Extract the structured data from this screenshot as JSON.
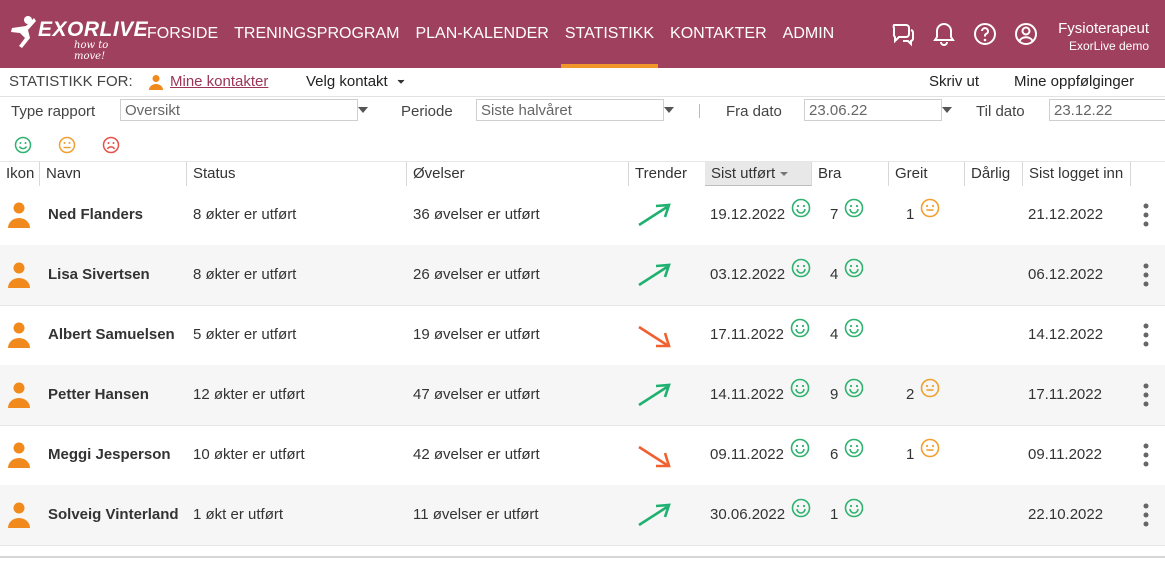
{
  "brand": {
    "name": "EXORLIVE",
    "tagline": "how to move!"
  },
  "nav": [
    {
      "label": "FORSIDE",
      "active": false
    },
    {
      "label": "TRENINGSPROGRAM",
      "active": false
    },
    {
      "label": "PLAN-KALENDER",
      "active": false
    },
    {
      "label": "STATISTIKK",
      "active": true
    },
    {
      "label": "KONTAKTER",
      "active": false
    },
    {
      "label": "ADMIN",
      "active": false
    }
  ],
  "top_icons": [
    "chat-icon",
    "bell-icon",
    "help-icon",
    "user-circle-icon"
  ],
  "user": {
    "name": "Fysioterapeut",
    "org": "ExorLive demo"
  },
  "subbar": {
    "label": "STATISTIKK FOR:",
    "contacts_link": "Mine kontakter",
    "select_contact": "Velg kontakt",
    "print": "Skriv ut",
    "followups": "Mine oppfølginger"
  },
  "filters": {
    "report_type_label": "Type rapport",
    "report_type_value": "Oversikt",
    "period_label": "Periode",
    "period_value": "Siste halvåret",
    "from_label": "Fra dato",
    "from_value": "23.06.22",
    "to_label": "Til dato",
    "to_value": "23.12.22"
  },
  "mood_filters": [
    "happy-face-icon",
    "neutral-face-icon",
    "sad-face-icon"
  ],
  "table": {
    "headers": {
      "icon": "Ikon",
      "name": "Navn",
      "status": "Status",
      "exercises": "Øvelser",
      "trends": "Trender",
      "last_done": "Sist utført",
      "good": "Bra",
      "ok": "Greit",
      "bad": "Dårlig",
      "last_login": "Sist logget inn"
    },
    "sorted_by": "last_done",
    "rows": [
      {
        "name": "Ned Flanders",
        "status": "8 økter er utført",
        "exercises": "36 øvelser er utført",
        "trend": "up",
        "last_done": "19.12.2022",
        "good": "7",
        "ok": "1",
        "bad": "",
        "last_login": "21.12.2022"
      },
      {
        "name": "Lisa Sivertsen",
        "status": "8 økter er utført",
        "exercises": "26 øvelser er utført",
        "trend": "up",
        "last_done": "03.12.2022",
        "good": "4",
        "ok": "",
        "bad": "",
        "last_login": "06.12.2022"
      },
      {
        "name": "Albert Samuelsen",
        "status": "5 økter er utført",
        "exercises": "19 øvelser er utført",
        "trend": "down",
        "last_done": "17.11.2022",
        "good": "4",
        "ok": "",
        "bad": "",
        "last_login": "14.12.2022"
      },
      {
        "name": "Petter Hansen",
        "status": "12 økter er utført",
        "exercises": "47 øvelser er utført",
        "trend": "up",
        "last_done": "14.11.2022",
        "good": "9",
        "ok": "2",
        "bad": "",
        "last_login": "17.11.2022"
      },
      {
        "name": "Meggi Jesperson",
        "status": "10 økter er utført",
        "exercises": "42 øvelser er utført",
        "trend": "down",
        "last_done": "09.11.2022",
        "good": "6",
        "ok": "1",
        "bad": "",
        "last_login": "09.11.2022"
      },
      {
        "name": "Solveig Vinterland",
        "status": "1 økt er utført",
        "exercises": "11 øvelser er utført",
        "trend": "up",
        "last_done": "30.06.2022",
        "good": "1",
        "ok": "",
        "bad": "",
        "last_login": "22.10.2022"
      }
    ]
  },
  "colors": {
    "header_bg": "#a0405f",
    "nav_active": "#f0962a",
    "link": "#9b3456",
    "good": "#2fb26f",
    "ok": "#f0a030",
    "bad": "#e8504a",
    "trend_up": "#20b070",
    "trend_down": "#f06030",
    "person": "#f08a1c"
  }
}
